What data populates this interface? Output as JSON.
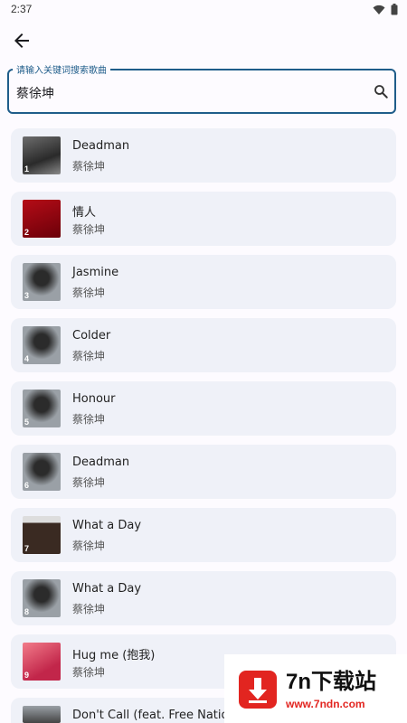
{
  "status": {
    "time": "2:37"
  },
  "search": {
    "label": "请输入关键词搜索歌曲",
    "value": "蔡徐坤"
  },
  "songs": [
    {
      "index": "1",
      "title": "Deadman",
      "artist": "蔡徐坤"
    },
    {
      "index": "2",
      "title": "情人",
      "artist": "蔡徐坤"
    },
    {
      "index": "3",
      "title": "Jasmine",
      "artist": "蔡徐坤"
    },
    {
      "index": "4",
      "title": "Colder",
      "artist": "蔡徐坤"
    },
    {
      "index": "5",
      "title": "Honour",
      "artist": "蔡徐坤"
    },
    {
      "index": "6",
      "title": "Deadman",
      "artist": "蔡徐坤"
    },
    {
      "index": "7",
      "title": "What a Day",
      "artist": "蔡徐坤"
    },
    {
      "index": "8",
      "title": "What a Day",
      "artist": "蔡徐坤"
    },
    {
      "index": "9",
      "title": "Hug me (抱我)",
      "artist": "蔡徐坤"
    },
    {
      "index": "",
      "title": "Don't Call (feat. Free Nation",
      "artist": ""
    }
  ],
  "promo": {
    "brand": "7n下载站",
    "url": "www.7ndn.com"
  },
  "colors": {
    "accent": "#1f5d8a",
    "card": "#eff1f8",
    "promo_red": "#e22520"
  }
}
